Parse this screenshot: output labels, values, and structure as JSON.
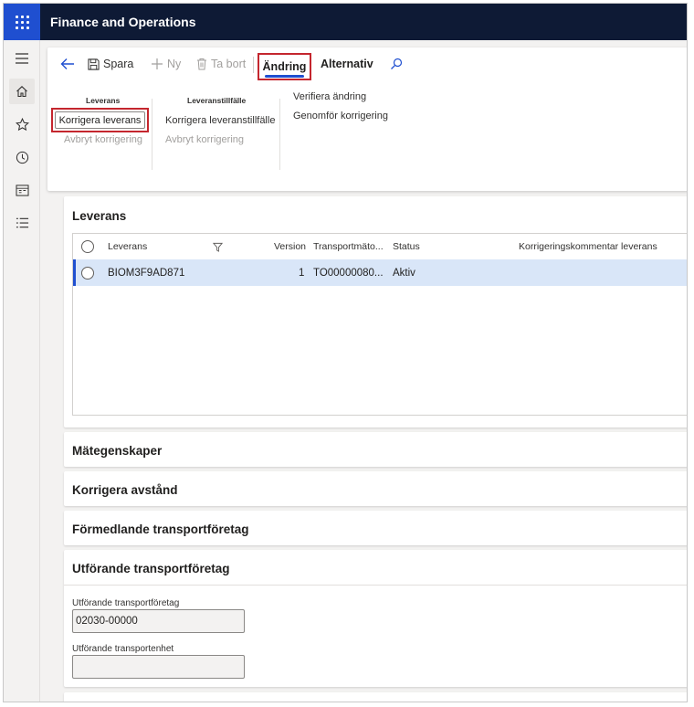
{
  "app": {
    "title": "Finance and Operations"
  },
  "toolbar": {
    "save_label": "Spara",
    "new_label": "Ny",
    "delete_label": "Ta bort",
    "tab_active": "Ändring",
    "tab_options": "Alternativ"
  },
  "ribbon": {
    "group_shipment": {
      "title": "Leverans",
      "correct_label": "Korrigera leverans",
      "cancel_label": "Avbryt korrigering"
    },
    "group_shipment_instance": {
      "title": "Leveranstillfälle",
      "correct_label": "Korrigera leveranstillfälle",
      "cancel_label": "Avbryt korrigering"
    },
    "group_misc": {
      "verify_label": "Verifiera ändring",
      "apply_label": "Genomför korrigering"
    }
  },
  "shipment_section": {
    "title": "Leverans",
    "columns": {
      "shipment": "Leverans",
      "version": "Version",
      "transport": "Transportmäto...",
      "status": "Status",
      "comment": "Korrigeringskommentar leverans"
    },
    "rows": [
      {
        "shipment": "BIOM3F9AD871",
        "version": "1",
        "transport": "TO00000080...",
        "status": "Aktiv",
        "comment": ""
      }
    ]
  },
  "sections": {
    "measure": "Mätegenskaper",
    "distance": "Korrigera avstånd",
    "intermediary": "Förmedlande transportföretag",
    "carrier": "Utförande transportföretag"
  },
  "carrier_fields": {
    "carrier_label": "Utförande transportföretag",
    "carrier_value": "02030-00000",
    "unit_label": "Utförande transportenhet",
    "unit_value": ""
  },
  "colors": {
    "topbar": "#0e1a35",
    "waffle": "#1f4fd0",
    "accent": "#1f4fd0",
    "highlight": "#c4262e",
    "selected_row": "#d9e6f8"
  },
  "icons": {
    "waffle": "waffle-icon",
    "menu": "hamburger-icon",
    "home": "home-icon",
    "favorites": "star-icon",
    "recent": "clock-icon",
    "workspaces": "workspace-icon",
    "modules": "list-icon",
    "back": "back-arrow-icon",
    "save": "save-icon",
    "new": "plus-icon",
    "delete": "trash-icon",
    "search": "search-icon",
    "filter": "filter-icon"
  }
}
